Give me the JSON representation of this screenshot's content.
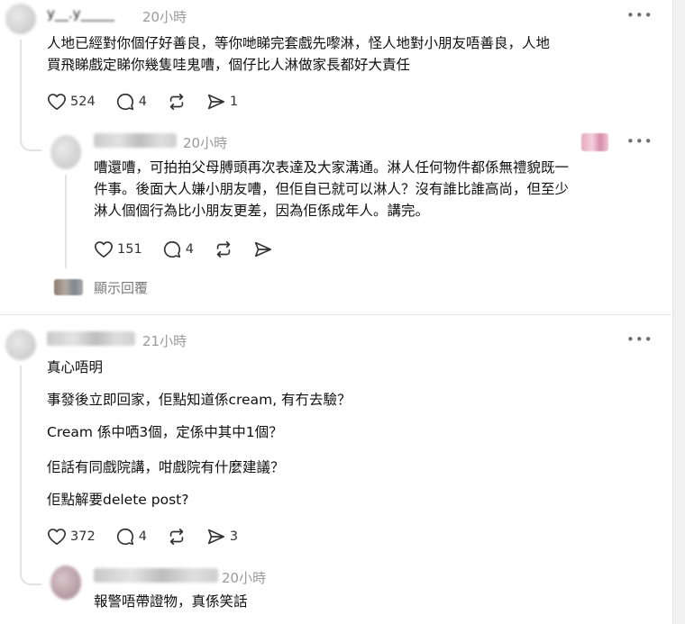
{
  "comments": [
    {
      "time": "20小時",
      "lines": [
        "人地已經對你個仔好善良，等你哋睇完套戲先嚟淋，怪人地對小朋友唔善良，人地",
        "買飛睇戲定睇你幾隻哇鬼嘈，個仔比人淋做家長都好大責任"
      ],
      "likes": "524",
      "replies": "4",
      "reposts": "",
      "shares": "1"
    },
    {
      "time": "20小時",
      "lines": [
        "嘈還嘈，可拍拍父母膊頭再次表達及大家溝通。淋人任何物件都係無禮貌既一",
        "件事。後面大人嫌小朋友嘈，但佢自已就可以淋人？沒有誰比誰高尚，但至少",
        "淋人個個行為比小朋友更差，因為佢係成年人。講完。"
      ],
      "likes": "151",
      "replies": "4",
      "reposts": "",
      "shares": ""
    },
    {
      "time": "21小時",
      "paragraphs": [
        "真心唔明",
        "事發後立即回家，佢點知道係cream, 有冇去驗？",
        "Cream 係中哂3個，定係中其中1個？",
        "佢話有同戲院講，咁戲院有什麼建議？",
        "佢點解要delete post?"
      ],
      "likes": "372",
      "replies": "4",
      "reposts": "",
      "shares": "3"
    },
    {
      "time": "20小時",
      "lines": [
        "報警唔帶證物，真係笑話"
      ]
    }
  ],
  "show_replies_label": "顯示回覆",
  "more_label": "•••",
  "partial_username": "y__.y_____"
}
